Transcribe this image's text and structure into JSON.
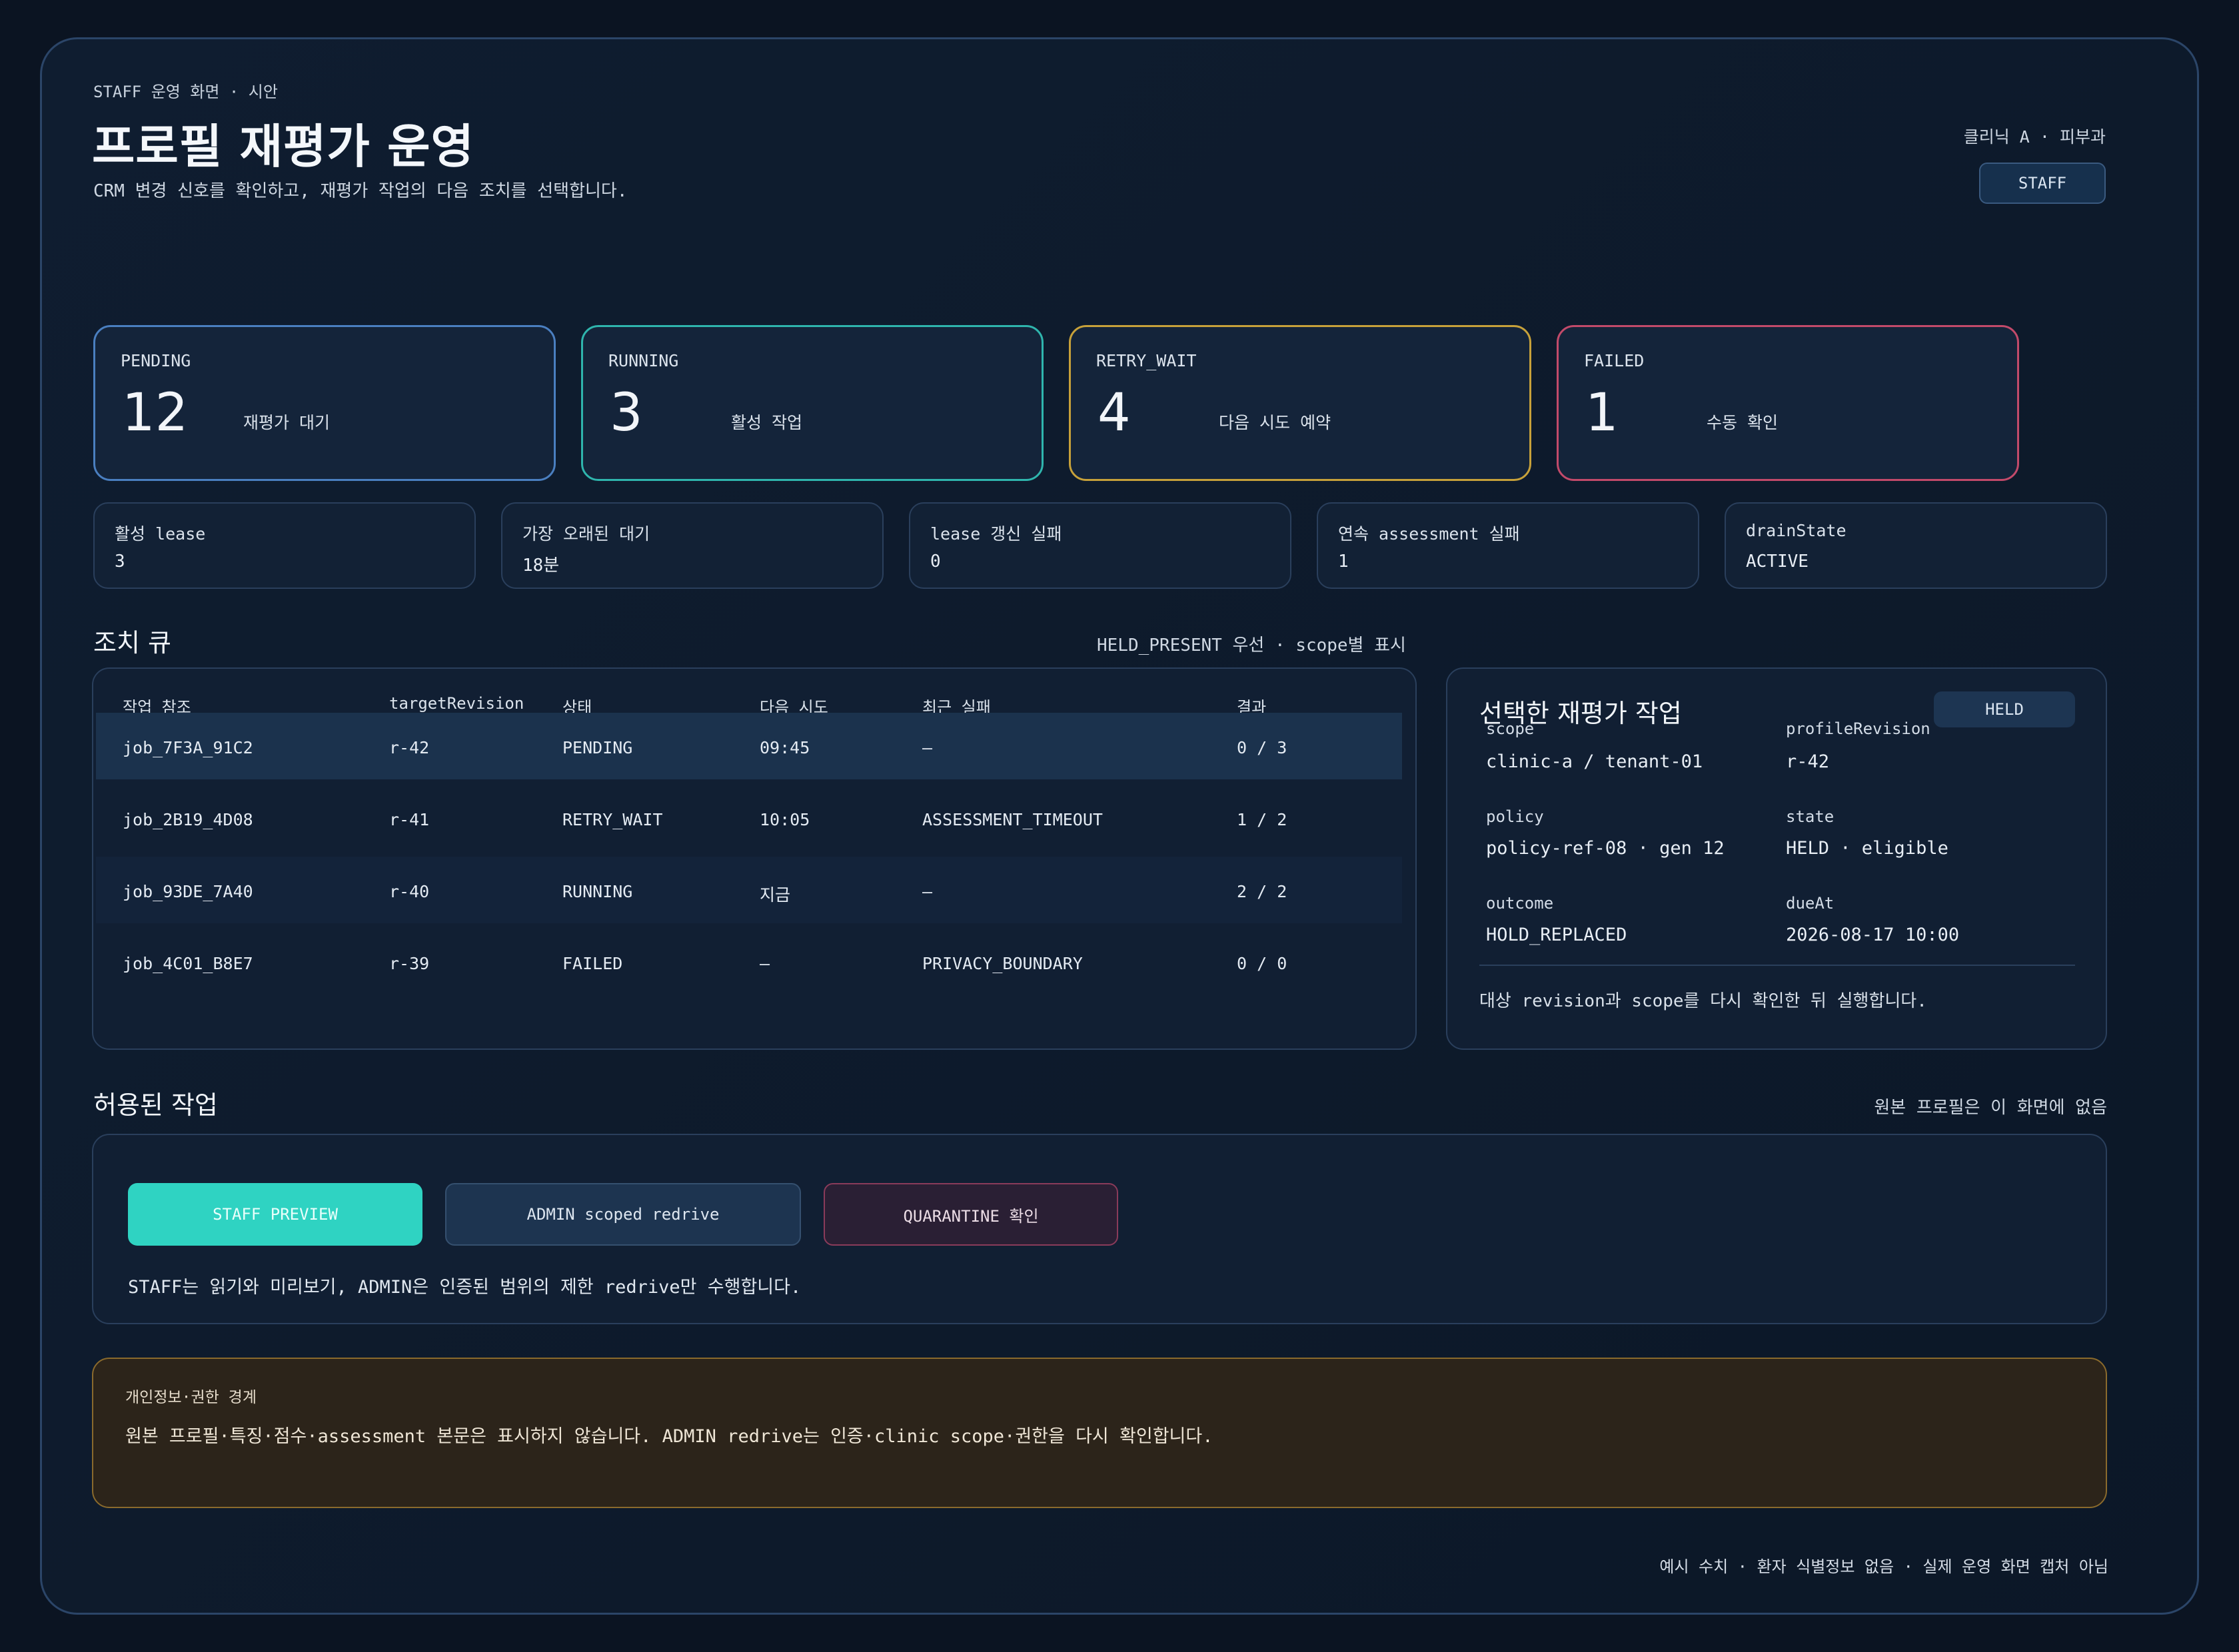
{
  "header": {
    "eyebrow": "STAFF 운영 화면 · 시안",
    "title": "프로필 재평가 운영",
    "subtitle": "CRM 변경 신호를 확인하고, 재평가 작업의 다음 조치를 선택합니다.",
    "clinic": "클리닉 A · 피부과",
    "role_label": "STAFF"
  },
  "stats": [
    {
      "label": "PENDING",
      "value": "12",
      "desc": "재평가 대기",
      "color": "#4a7fc0"
    },
    {
      "label": "RUNNING",
      "value": "3",
      "desc": "활성 작업",
      "color": "#2fb5ad"
    },
    {
      "label": "RETRY_WAIT",
      "value": "4",
      "desc": "다음 시도 예약",
      "color": "#c7a13a"
    },
    {
      "label": "FAILED",
      "value": "1",
      "desc": "수동 확인",
      "color": "#c24a6a"
    }
  ],
  "metrics": [
    {
      "label": "활성 lease",
      "value": "3"
    },
    {
      "label": "가장 오래된 대기",
      "value": "18분"
    },
    {
      "label": "lease 갱신 실패",
      "value": "0"
    },
    {
      "label": "연속 assessment 실패",
      "value": "1"
    },
    {
      "label": "drainState",
      "value": "ACTIVE"
    }
  ],
  "queue": {
    "title": "조치 큐",
    "note": "HELD_PRESENT 우선 · scope별 표시",
    "columns": [
      "작업 참조",
      "targetRevision",
      "상태",
      "다음 시도",
      "최근 실패",
      "결과"
    ],
    "rows": [
      [
        "job_7F3A_91C2",
        "r-42",
        "PENDING",
        "09:45",
        "—",
        "0 / 3"
      ],
      [
        "job_2B19_4D08",
        "r-41",
        "RETRY_WAIT",
        "10:05",
        "ASSESSMENT_TIMEOUT",
        "1 / 2"
      ],
      [
        "job_93DE_7A40",
        "r-40",
        "RUNNING",
        "지금",
        "—",
        "2 / 2"
      ],
      [
        "job_4C01_B8E7",
        "r-39",
        "FAILED",
        "—",
        "PRIVACY_BOUNDARY",
        "0 / 0"
      ]
    ]
  },
  "detail": {
    "title": "선택한 재평가 작업",
    "badge": "HELD",
    "fields": [
      {
        "key": "scope",
        "value": "clinic-a / tenant-01"
      },
      {
        "key": "profileRevision",
        "value": "r-42"
      },
      {
        "key": "policy",
        "value": "policy-ref-08 · gen 12"
      },
      {
        "key": "state",
        "value": "HELD · eligible"
      },
      {
        "key": "outcome",
        "value": "HOLD_REPLACED"
      },
      {
        "key": "dueAt",
        "value": "2026-08-17 10:00"
      }
    ],
    "note": "대상 revision과 scope를 다시 확인한 뒤 실행합니다."
  },
  "actions": {
    "title": "허용된 작업",
    "note": "원본 프로필은 이 화면에 없음",
    "buttons": [
      "STAFF PREVIEW",
      "ADMIN scoped redrive",
      "QUARANTINE 확인"
    ],
    "description": "STAFF는 읽기와 미리보기, ADMIN은 인증된 범위의 제한 redrive만 수행합니다."
  },
  "privacy": {
    "title": "개인정보·권한 경계",
    "text": "원본 프로필·특징·점수·assessment 본문은 표시하지 않습니다. ADMIN redrive는 인증·clinic scope·권한을 다시 확인합니다."
  },
  "footer": "예시 수치 · 환자 식별정보 없음 · 실제 운영 화면 캡처 아님"
}
